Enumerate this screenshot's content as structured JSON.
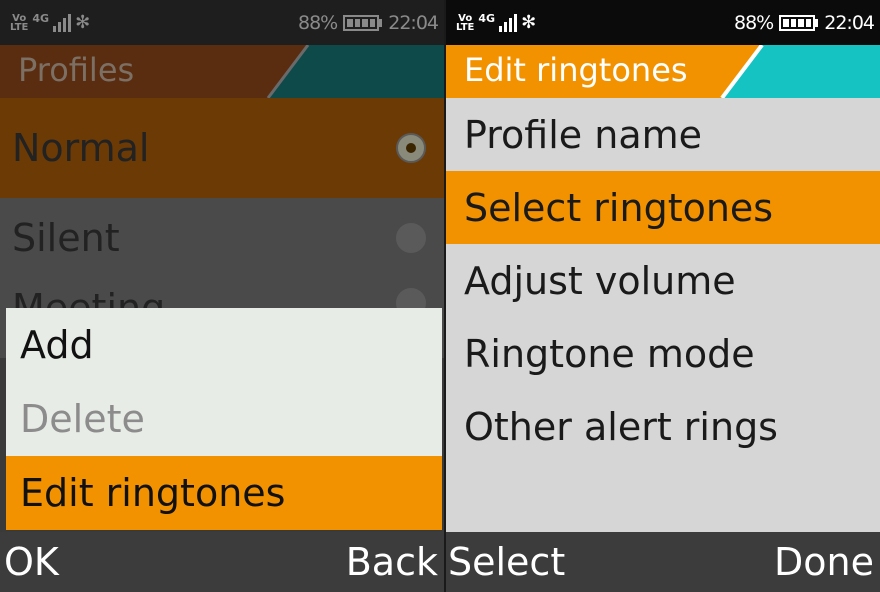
{
  "left_screen": {
    "status": {
      "battery": "88%",
      "time": "22:04"
    },
    "title": "Profiles",
    "profiles": [
      {
        "label": "Normal",
        "selected": true
      },
      {
        "label": "Silent",
        "selected": false
      },
      {
        "label": "Meeting",
        "selected": false
      }
    ],
    "menu": [
      {
        "label": "Add",
        "enabled": true
      },
      {
        "label": "Delete",
        "enabled": false
      },
      {
        "label": "Edit ringtones",
        "enabled": true,
        "highlighted": true
      }
    ],
    "softkeys": {
      "left": "OK",
      "right": "Back"
    }
  },
  "right_screen": {
    "status": {
      "battery": "88%",
      "time": "22:04"
    },
    "title": "Edit ringtones",
    "items": [
      {
        "label": "Profile name"
      },
      {
        "label": "Select ringtones",
        "highlighted": true
      },
      {
        "label": "Adjust volume"
      },
      {
        "label": "Ringtone mode"
      },
      {
        "label": "Other alert rings"
      }
    ],
    "softkeys": {
      "left": "Select",
      "right": "Done"
    }
  },
  "colors": {
    "accent_orange": "#f39200",
    "title_teal": "#16c3c3",
    "dim_title_bg": "#5a2c10",
    "dim_highlight": "#6b3a05"
  }
}
